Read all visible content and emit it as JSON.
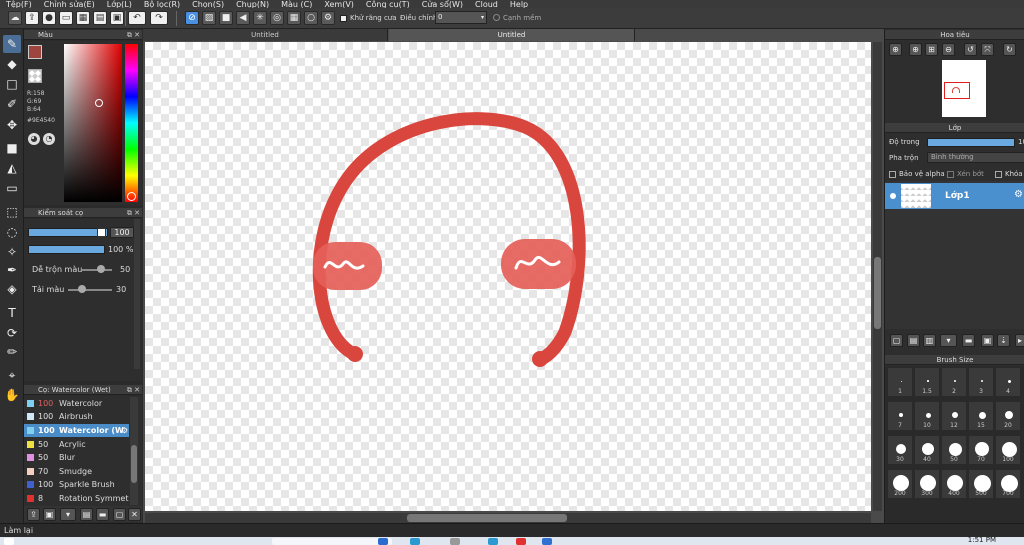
{
  "menubar": {
    "items": [
      "Tệp(F)",
      "Chỉnh sửa(E)",
      "Lớp(L)",
      "Bộ lọc(R)",
      "Chọn(S)",
      "Chụp(N)",
      "Màu (C)",
      "Xem(V)",
      "Công cụ(T)",
      "Cửa sổ(W)",
      "Cloud",
      "Help"
    ]
  },
  "toolbar": {
    "antialias_label": "Khử răng cưa",
    "adjust_label": "Điều chỉnh",
    "adjust_value": "0",
    "soft_edge_label": "Cạnh mềm"
  },
  "color_panel": {
    "title": "Màu",
    "r": "R:158",
    "g": "G:69",
    "b": "B:64",
    "hex": "#9E4540",
    "main_color": "#9e4540",
    "secondary_color": "#e0205a"
  },
  "brush_control": {
    "title": "Kiểm soát cọ",
    "size_value": "100",
    "opacity_value": "100 %",
    "blend_label": "Dễ trộn màu",
    "blend_value": "50",
    "reload_label": "Tải màu",
    "reload_value": "30"
  },
  "brush_list": {
    "title": "Cọ: Watercolor (Wet)",
    "items": [
      {
        "size": "100",
        "name": "Watercolor",
        "color": "#7fd0f0",
        "selected": false
      },
      {
        "size": "100",
        "name": "Airbrush",
        "color": "#cfe8f5",
        "selected": false
      },
      {
        "size": "100",
        "name": "Watercolor (W",
        "color": "#7fd0f0",
        "selected": true
      },
      {
        "size": "50",
        "name": "Acrylic",
        "color": "#f0e040",
        "selected": false
      },
      {
        "size": "50",
        "name": "Blur",
        "color": "#e090e0",
        "selected": false
      },
      {
        "size": "70",
        "name": "Smudge",
        "color": "#f5d0c0",
        "selected": false
      },
      {
        "size": "100",
        "name": "Sparkle Brush",
        "color": "#4060d0",
        "selected": false
      },
      {
        "size": "8",
        "name": "Rotation Symmetr",
        "color": "#e03030",
        "selected": false
      }
    ]
  },
  "canvas": {
    "tabs": [
      "Untitled",
      "Untitled"
    ],
    "stroke_color": "#d9463e"
  },
  "navigator": {
    "title": "Hoa tiêu"
  },
  "layer_panel": {
    "title": "Lớp",
    "opacity_label": "Độ trong",
    "opacity_value": "100",
    "blend_label": "Pha trộn",
    "blend_value": "Bình thường",
    "protect_alpha": "Bảo vệ alpha",
    "clipping": "Xén bớt",
    "lock": "Khóa",
    "layer_name": "Lớp1"
  },
  "brush_size": {
    "title": "Brush Size",
    "sizes": [
      "1",
      "1.5",
      "2",
      "3",
      "4",
      "7",
      "10",
      "12",
      "15",
      "20",
      "30",
      "40",
      "50",
      "70",
      "100",
      "200",
      "300",
      "400",
      "500",
      "700"
    ]
  },
  "status": {
    "text": "Làm lại"
  },
  "taskbar": {
    "time": "1:51 PM"
  }
}
